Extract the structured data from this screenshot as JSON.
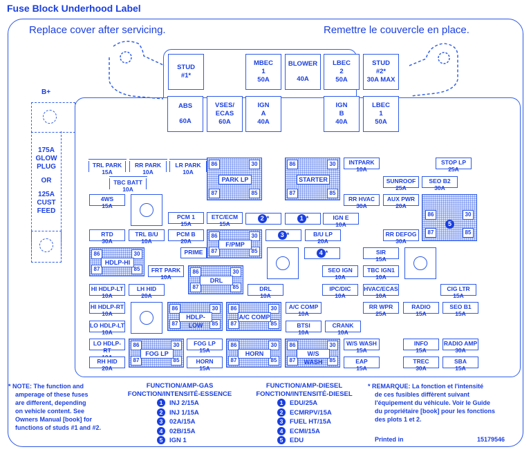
{
  "title": "Fuse Block  Underhood Label",
  "header": {
    "left": "Replace cover after servicing.",
    "right": "Remettre le couvercle en place."
  },
  "bplus": {
    "label": "B+",
    "lines": [
      "175A",
      "GLOW",
      "PLUG",
      "OR",
      "125A",
      "CUST",
      "FEED"
    ]
  },
  "top_row": [
    {
      "lines": [
        "STUD",
        "#1*"
      ]
    },
    {
      "lines": [
        "MBEC",
        "1",
        "50A"
      ]
    },
    {
      "lines": [
        "BLOWER",
        "",
        "40A"
      ]
    },
    {
      "lines": [
        "LBEC",
        "2",
        "50A"
      ]
    },
    {
      "lines": [
        "STUD",
        "#2*",
        "30A MAX"
      ]
    }
  ],
  "second_row": [
    {
      "lines": [
        "ABS",
        "",
        "60A"
      ]
    },
    {
      "lines": [
        "VSES/",
        "ECAS",
        "60A"
      ]
    },
    {
      "lines": [
        "IGN",
        "A",
        "40A"
      ]
    },
    {
      "lines": [
        "IGN",
        "B",
        "40A"
      ]
    },
    {
      "lines": [
        "LBEC",
        "1",
        "50A"
      ]
    }
  ],
  "fuses": {
    "trl_park": [
      "TRL PARK",
      "15A"
    ],
    "rr_park": [
      "RR PARK",
      "10A"
    ],
    "lr_park": [
      "LR PARK",
      "10A"
    ],
    "tbc_batt": [
      "TBC BATT",
      "10A"
    ],
    "4ws": [
      "4WS",
      "15A"
    ],
    "pcm1": [
      "PCM 1",
      "15A"
    ],
    "etc_ecm": [
      "ETC/ECM",
      "15A"
    ],
    "intpark": [
      "INTPARK",
      "10A"
    ],
    "stop_lp": [
      "STOP LP",
      "25A"
    ],
    "sunroof": [
      "SUNROOF",
      "25A"
    ],
    "seo_b2": [
      "SEO B2",
      "30A"
    ],
    "rr_hvac": [
      "RR HVAC",
      "30A"
    ],
    "aux_pwr": [
      "AUX PWR",
      "20A"
    ],
    "ign_e": [
      "IGN E",
      "10A"
    ],
    "rtd": [
      "RTD",
      "30A"
    ],
    "trl_bu": [
      "TRL B/U",
      "10A"
    ],
    "pcm_b": [
      "PCM B",
      "20A"
    ],
    "prime": [
      "PRIME"
    ],
    "bu_lp": [
      "B/U LP",
      "20A"
    ],
    "rr_defog": [
      "RR DEFOG",
      "30A"
    ],
    "sir": [
      "SIR",
      "15A"
    ],
    "frt_park": [
      "FRT PARK",
      "10A"
    ],
    "seo_ign": [
      "SEO IGN",
      "10A"
    ],
    "tbc_ign1": [
      "TBC IGN1",
      "10A"
    ],
    "hi_hdlp_lt": [
      "HI HDLP-LT",
      "10A"
    ],
    "lh_hid": [
      "LH HID",
      "20A"
    ],
    "drl": [
      "DRL",
      "10A"
    ],
    "ipc_dic": [
      "IPC/DIC",
      "10A"
    ],
    "hvac_ecas": [
      "HVAC/ECAS",
      "10A"
    ],
    "cig_ltr": [
      "CIG LTR",
      "15A"
    ],
    "hi_hdlp_rt": [
      "HI HDLP-RT",
      "10A"
    ],
    "ac_comp_f": [
      "A/C COMP",
      "10A"
    ],
    "rr_wpr": [
      "RR WPR",
      "25A"
    ],
    "radio": [
      "RADIO",
      "15A"
    ],
    "seo_b1": [
      "SEO B1",
      "15A"
    ],
    "lo_hdlp_lt": [
      "LO HDLP-LT",
      "10A"
    ],
    "btsi": [
      "BTSI",
      "10A"
    ],
    "crank": [
      "CRANK",
      "10A"
    ],
    "lo_hdlp_rt": [
      "LO HDLP-RT",
      "10A"
    ],
    "fog_lp_f": [
      "FOG LP",
      "15A"
    ],
    "ws_wash_f": [
      "W/S WASH",
      "15A"
    ],
    "info": [
      "INFO",
      "15A"
    ],
    "radio_amp": [
      "RADIO AMP",
      "30A"
    ],
    "rh_hid": [
      "RH HID",
      "20A"
    ],
    "horn_f": [
      "HORN",
      "15A"
    ],
    "eap": [
      "EAP",
      "15A"
    ],
    "trec": [
      "TREC",
      "30A"
    ],
    "sba": [
      "SBA",
      "15A"
    ]
  },
  "relays": {
    "pins": [
      "86",
      "30",
      "87",
      "85"
    ],
    "park_lp": "PARK LP",
    "starter": "STARTER",
    "f_pmp": "F/PMP",
    "hdlp_hi": "HDLP-HI",
    "drl": "DRL",
    "hdlp_low": "HDLP-LOW",
    "ac_comp": "A/C COMP",
    "fog_lp": "FOG LP",
    "horn": "HORN",
    "ws_wash": "W/S WASH",
    "relay5": "5"
  },
  "numbered": {
    "n1": "1",
    "n2": "2",
    "n3": "3",
    "n4": "4",
    "star": "*"
  },
  "note_en": [
    "* NOTE:  The function and",
    "amperage of these fuses",
    "are different, depending",
    "on vehicle content.  See",
    "Owners Manual [book] for",
    "functions of studs #1 and #2."
  ],
  "legend_gas": {
    "head1": "FUNCTION/AMP-GAS",
    "head2": "FONCTION/INTENSITÉ-ESSENCE",
    "items": [
      {
        "n": "1",
        "text": "INJ 2/15A"
      },
      {
        "n": "2",
        "text": "INJ 1/15A"
      },
      {
        "n": "3",
        "text": "02A/15A"
      },
      {
        "n": "4",
        "text": "02B/15A"
      },
      {
        "n": "5",
        "text": "IGN 1"
      }
    ]
  },
  "legend_diesel": {
    "head1": "FUNCTION/AMP-DIESEL",
    "head2": "FONCTION/INTENSITÉ-DIESEL",
    "items": [
      {
        "n": "1",
        "text": "EDU/25A"
      },
      {
        "n": "2",
        "text": "ECMRPV/15A"
      },
      {
        "n": "3",
        "text": "FUEL HT/15A"
      },
      {
        "n": "4",
        "text": "ECMI/15A"
      },
      {
        "n": "5",
        "text": "EDU"
      }
    ]
  },
  "note_fr": [
    "* REMARQUE:  La fonction et l'intensité",
    "de ces fusibles diffèrent suivant",
    "l'équipement du véhicule. Voir le Guide",
    "du propriétaire [book] pour les fonctions",
    "des plots 1 et 2."
  ],
  "printed_in": "Printed in",
  "part_number": "15179546"
}
